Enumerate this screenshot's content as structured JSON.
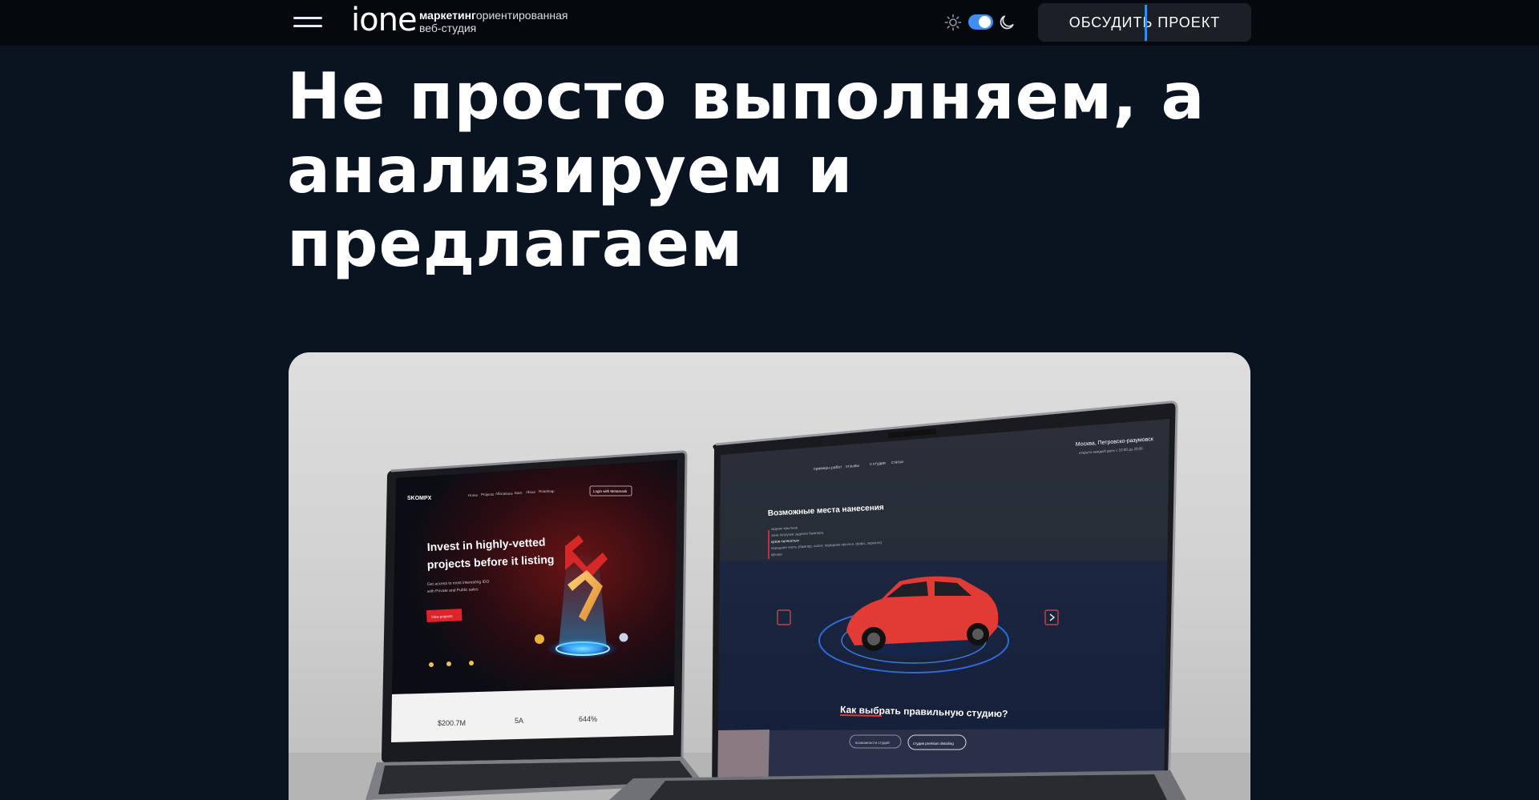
{
  "header": {
    "menu_icon": "hamburger-menu-icon",
    "logo": "ione",
    "tagline_bold": "маркетинг",
    "tagline_line1_rest": "ориентированная",
    "tagline_line2": "веб-студия",
    "theme_toggle": {
      "state": "dark",
      "sun_icon": "sun-icon",
      "moon_icon": "moon-icon",
      "accent": "#3f8ef0"
    },
    "cta_label": "ОБСУДИТЬ ПРОЕКТ"
  },
  "hero": {
    "headline_line1": "Не просто выполняем, а",
    "headline_line2": "анализируем и предлагаем"
  },
  "showcase": {
    "left_screen": {
      "brand": "SKOMPX",
      "nav": [
        "Home",
        "Projects",
        "Allocations",
        "Earn",
        "About",
        "Roadmap"
      ],
      "login": "Login with Metamask",
      "headline_line1": "Invest in highly-vetted",
      "headline_line2": "projects before it listing",
      "sub_line1": "Get access to most interesting IDO",
      "sub_line2": "with Private and Public sales",
      "button": "View projects",
      "stats": [
        "$200.7M",
        "5A",
        "644%"
      ]
    },
    "right_screen": {
      "nav": [
        "примеры работ",
        "отзывы",
        "о студии",
        "статьи"
      ],
      "address": "Москва, Петровско-разумовск",
      "hours": "открыто каждый день с 10:00 до 20:00",
      "title": "Возможные места нанесения",
      "list": [
        "задних крыльев",
        "зона погрузки заднего бампера",
        "кузов полностью",
        "передняя часть (бампер, капот, передние крылья, фары, зеркала)",
        "крыша"
      ],
      "question": "Как выбрать правильную студию?",
      "buttons": [
        "возможности студий",
        "студия premium detailing"
      ]
    }
  },
  "colors": {
    "page_bg": "#0a1320",
    "topbar_bg": "#05080d",
    "cta_bg": "#1b2026",
    "accent": "#3f8ef0",
    "car_red": "#e23a34"
  }
}
